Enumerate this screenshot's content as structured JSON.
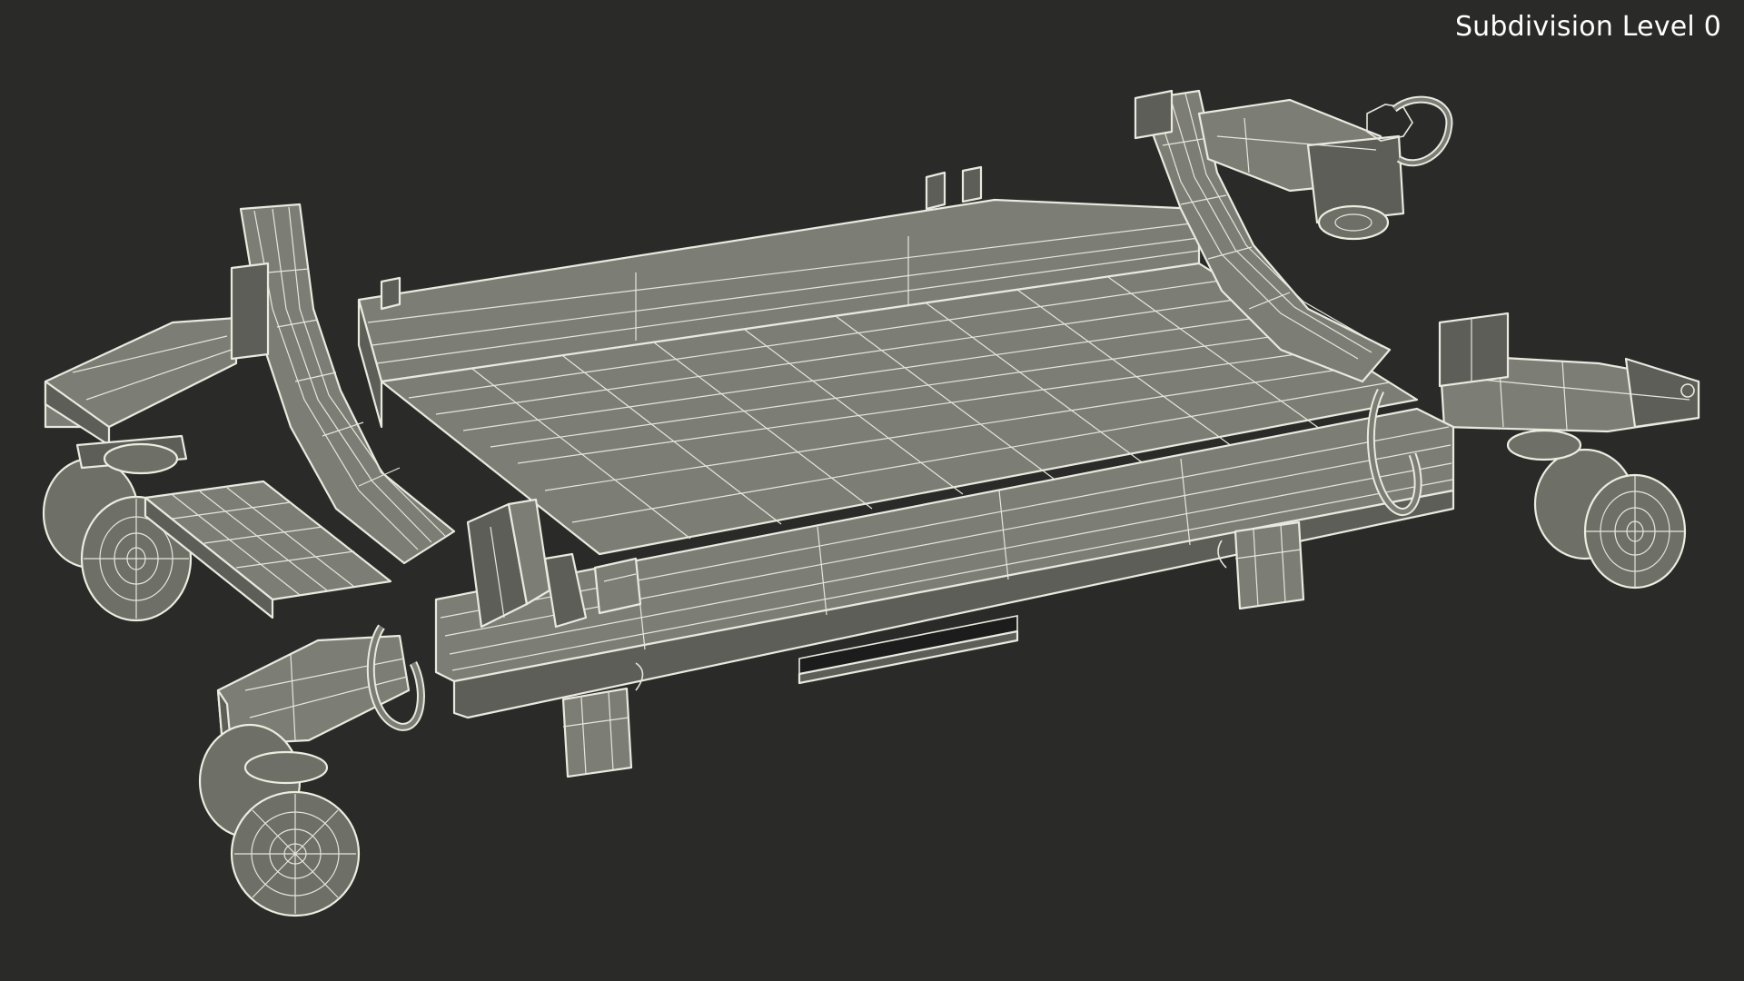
{
  "overlay": {
    "subdivision_label": "Subdivision Level 0"
  },
  "viewport": {
    "background_color": "#2a2a29",
    "mesh_fill_color": "#7c7d74",
    "wireframe_color": "#e9e9df"
  }
}
